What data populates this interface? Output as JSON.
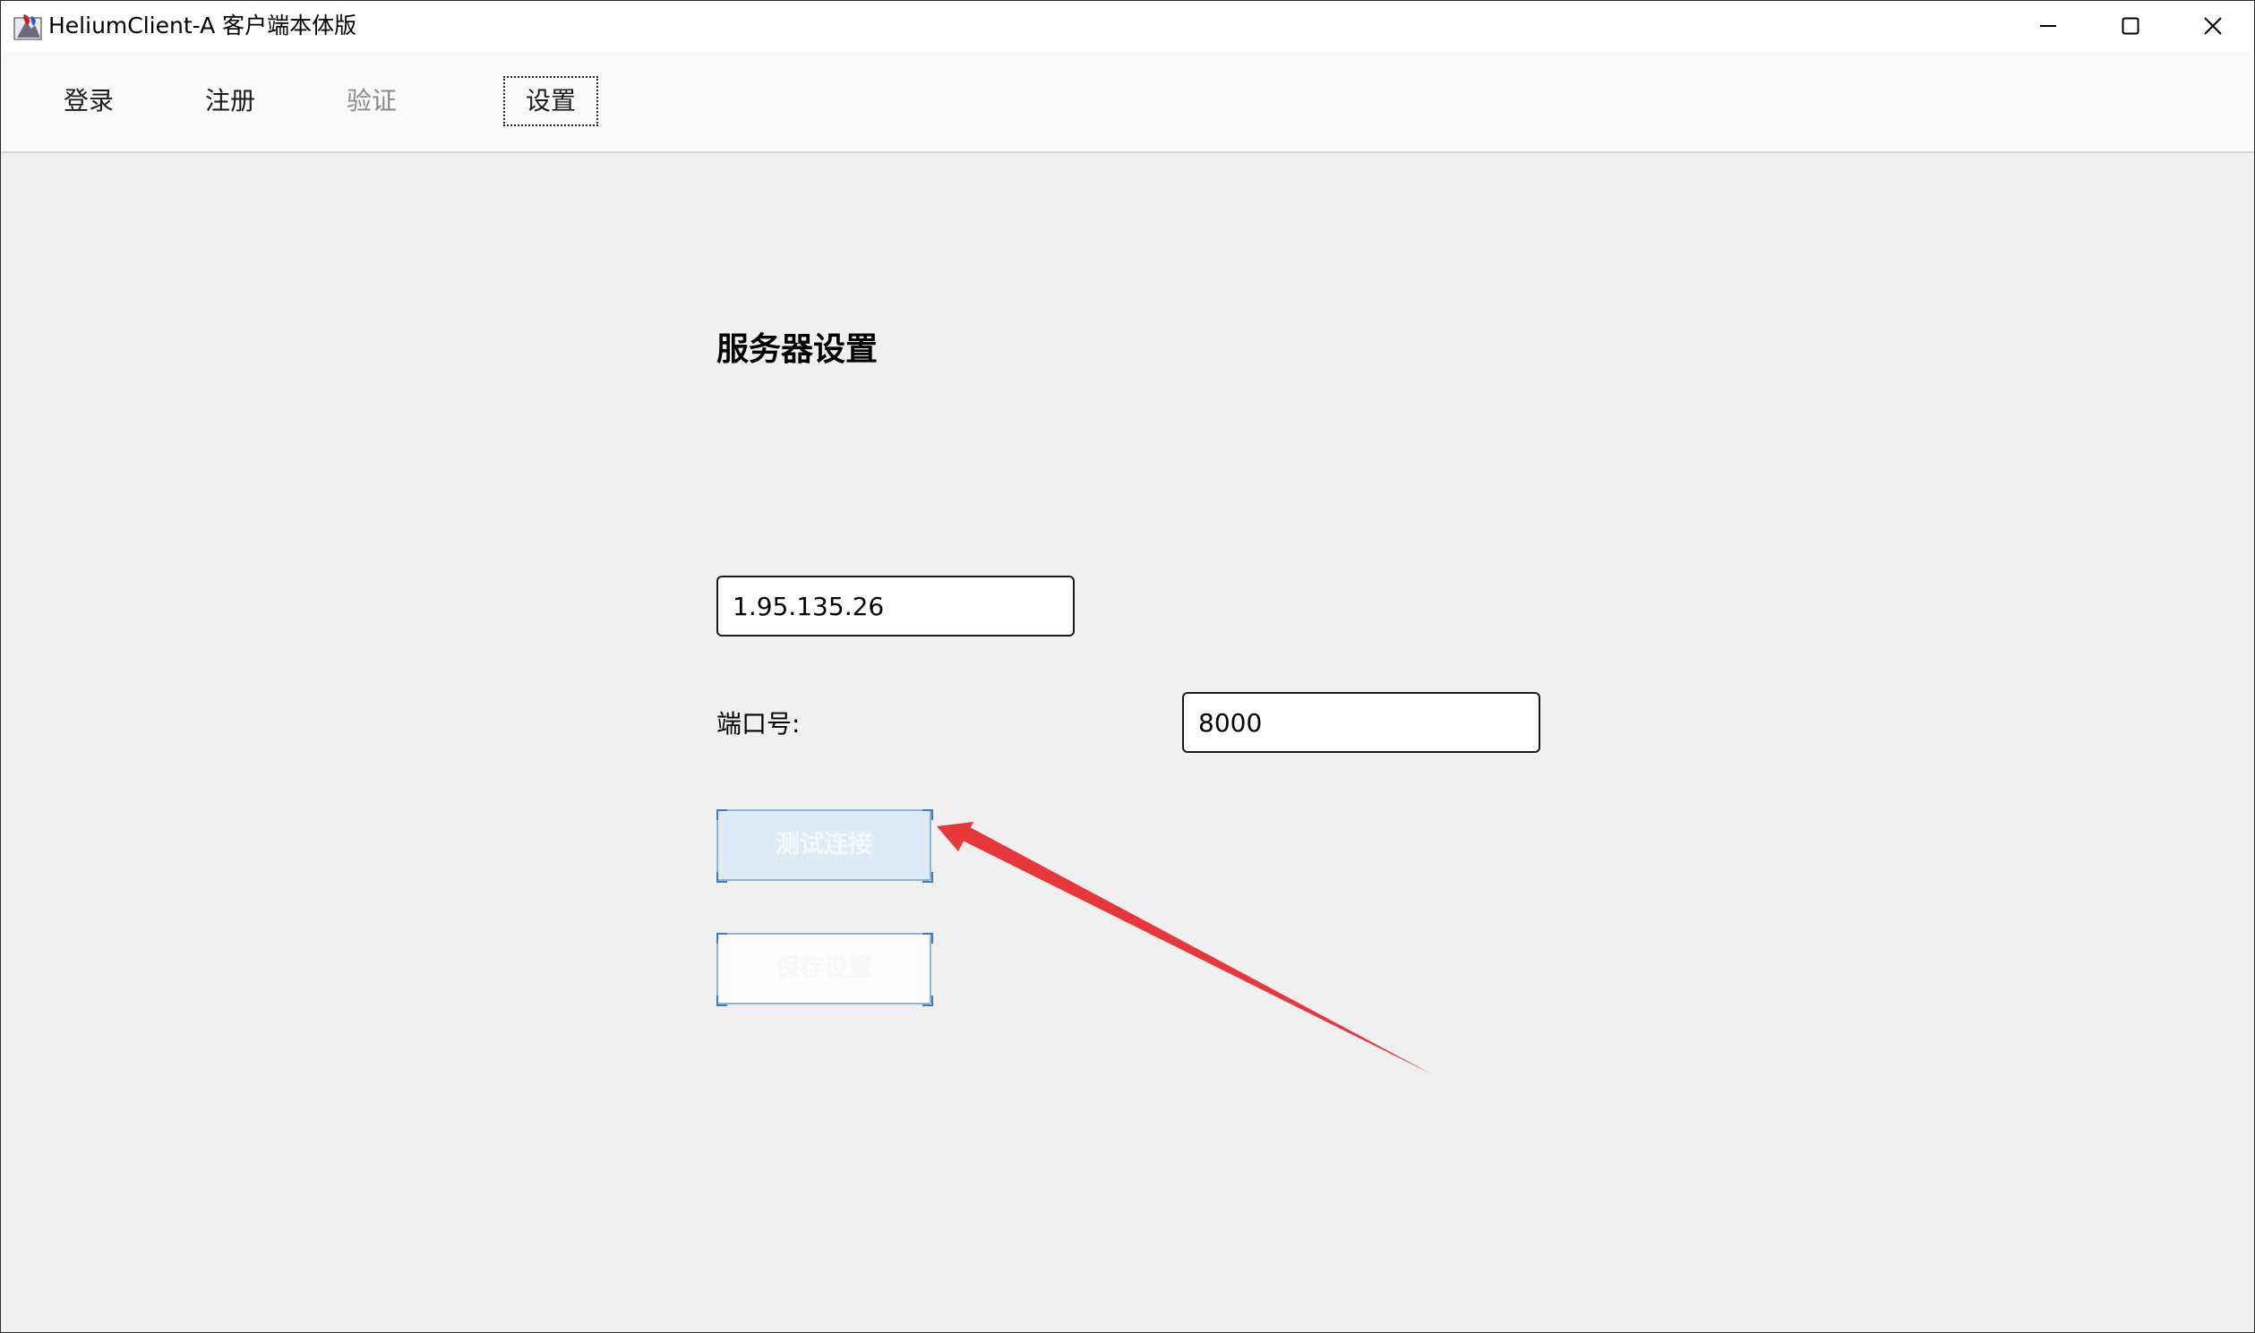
{
  "window": {
    "title": "HeliumClient-A 客户端本体版",
    "controls": {
      "minimize": "minimize-icon",
      "maximize": "maximize-icon",
      "close": "close-icon"
    }
  },
  "tabs": [
    {
      "label": "登录",
      "state": "normal"
    },
    {
      "label": "注册",
      "state": "normal"
    },
    {
      "label": "验证",
      "state": "disabled"
    },
    {
      "label": "设置",
      "state": "active"
    }
  ],
  "settings": {
    "title": "服务器设置",
    "server_address": "1.95.135.26",
    "port_label": "端口号:",
    "port_value": "8000",
    "test_button_label": "测试连接",
    "save_button_label": "保存设置"
  },
  "annotation": {
    "type": "arrow",
    "color": "#e8373a",
    "points_to": "test-connection-button"
  }
}
